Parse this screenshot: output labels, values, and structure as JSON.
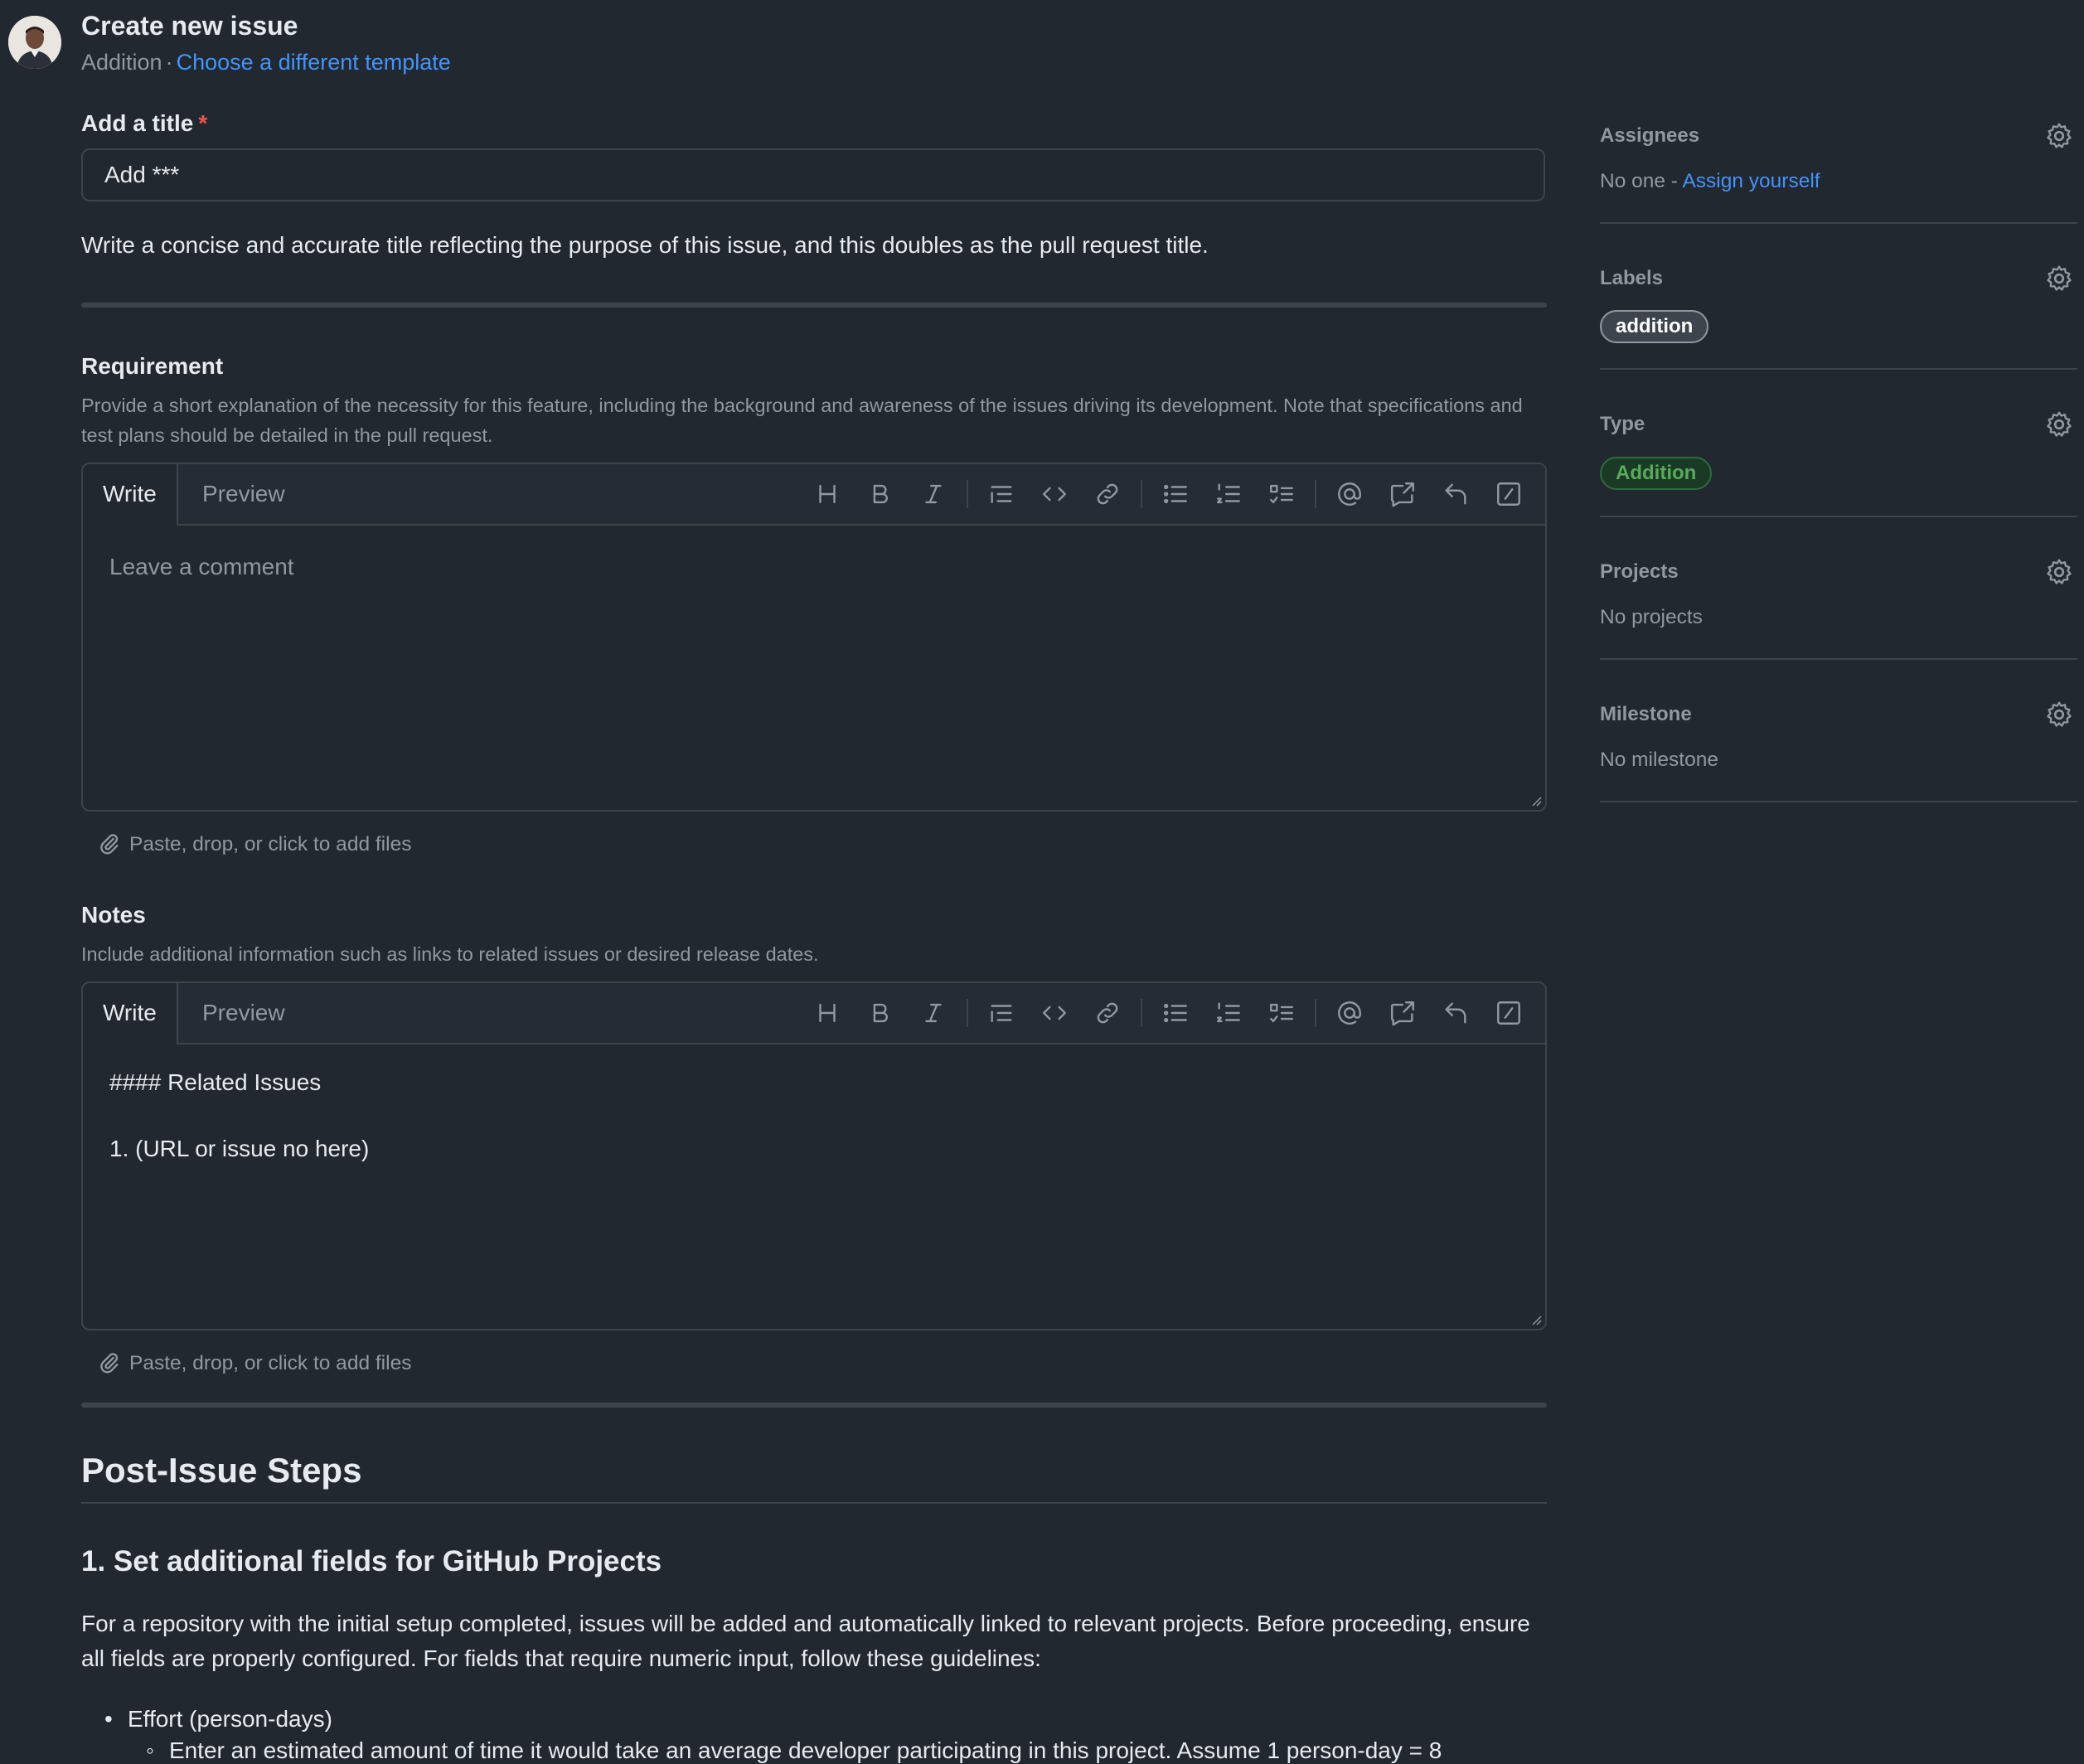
{
  "header": {
    "title": "Create new issue",
    "template_name": "Addition",
    "separator": "·",
    "change_template_link": "Choose a different template"
  },
  "title_field": {
    "label": "Add a title",
    "required_marker": "*",
    "value": "Add ***",
    "description": "Write a concise and accurate title reflecting the purpose of this issue, and this doubles as the pull request title."
  },
  "requirement": {
    "label": "Requirement",
    "hint": "Provide a short explanation of the necessity for this feature, including the background and awareness of the issues driving its development. Note that specifications and test plans should be detailed in the pull request.",
    "tab_write": "Write",
    "tab_preview": "Preview",
    "placeholder": "Leave a comment",
    "value": "",
    "attach_text": "Paste, drop, or click to add files"
  },
  "notes": {
    "label": "Notes",
    "hint": "Include additional information such as links to related issues or desired release dates.",
    "tab_write": "Write",
    "tab_preview": "Preview",
    "value": "#### Related Issues\n\n1. (URL or issue no here)",
    "attach_text": "Paste, drop, or click to add files"
  },
  "toolbar_icons": [
    "heading-icon",
    "bold-icon",
    "italic-icon",
    "quote-icon",
    "code-icon",
    "link-icon",
    "bulleted-list-icon",
    "numbered-list-icon",
    "task-list-icon",
    "mention-icon",
    "cross-reference-icon",
    "saved-reply-icon",
    "slash-command-icon"
  ],
  "post_issue": {
    "heading": "Post-Issue Steps",
    "step1_heading": "1. Set additional fields for GitHub Projects",
    "step1_text": "For a repository with the initial setup completed, issues will be added and automatically linked to relevant projects. Before proceeding, ensure all fields are properly configured. For fields that require numeric input, follow these guidelines:",
    "bullet1": "Effort (person-days)",
    "bullet1_sub": "Enter an estimated amount of time it would take an average developer participating in this project. Assume 1 person-day = 8"
  },
  "sidebar": {
    "assignees": {
      "heading": "Assignees",
      "value_prefix": "No one - ",
      "value_link": "Assign yourself"
    },
    "labels": {
      "heading": "Labels",
      "pill": "addition"
    },
    "type": {
      "heading": "Type",
      "pill": "Addition"
    },
    "projects": {
      "heading": "Projects",
      "value": "No projects"
    },
    "milestone": {
      "heading": "Milestone",
      "value": "No milestone"
    }
  },
  "colors": {
    "background": "#212830",
    "border": "#3d444d",
    "link": "#4493f8",
    "required": "#f85149",
    "type_pill": "#57ab5a"
  }
}
